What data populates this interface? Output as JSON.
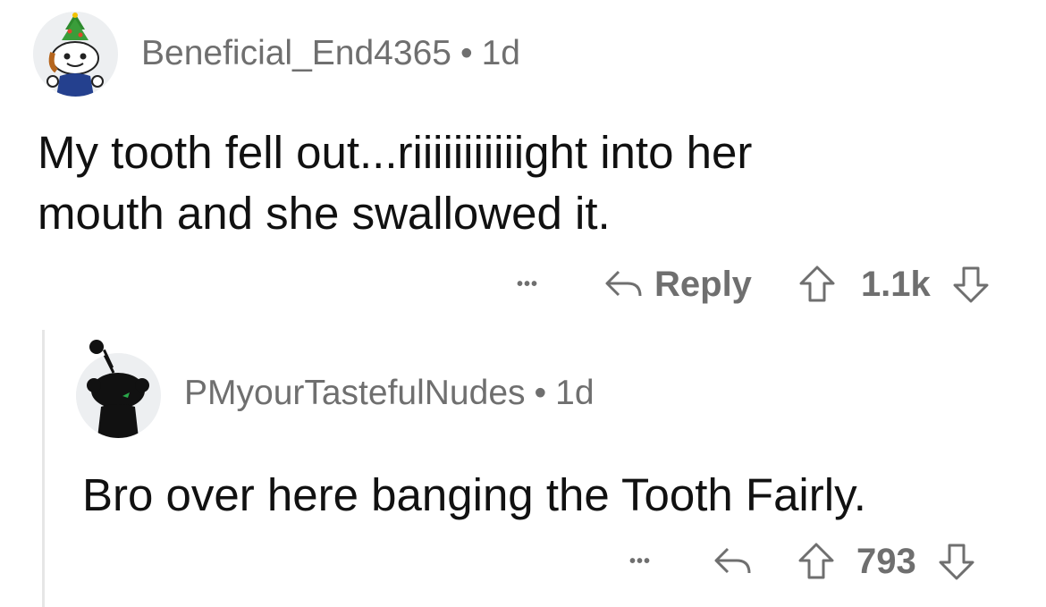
{
  "comments": [
    {
      "username": "Beneficial_End4365",
      "separator": "•",
      "age": "1d",
      "body_lines": [
        "My tooth fell out...riiiiiiiiiiight into her",
        "mouth and she swallowed it."
      ],
      "more": "•••",
      "reply_label": "Reply",
      "score": "1.1k",
      "avatar_icon": "snoo-christmas-tree-hat-icon"
    },
    {
      "username": "PMyourTastefulNudes",
      "separator": "•",
      "age": "1d",
      "body_lines": [
        "Bro over here banging the Tooth Fairly."
      ],
      "more": "•••",
      "score": "793",
      "avatar_icon": "snoo-silhouette-icon"
    }
  ],
  "colors": {
    "meta": "#6f6f6f",
    "text": "#111111",
    "thread_line": "#e6e6e6",
    "avatar_bg": "#edeff1"
  }
}
